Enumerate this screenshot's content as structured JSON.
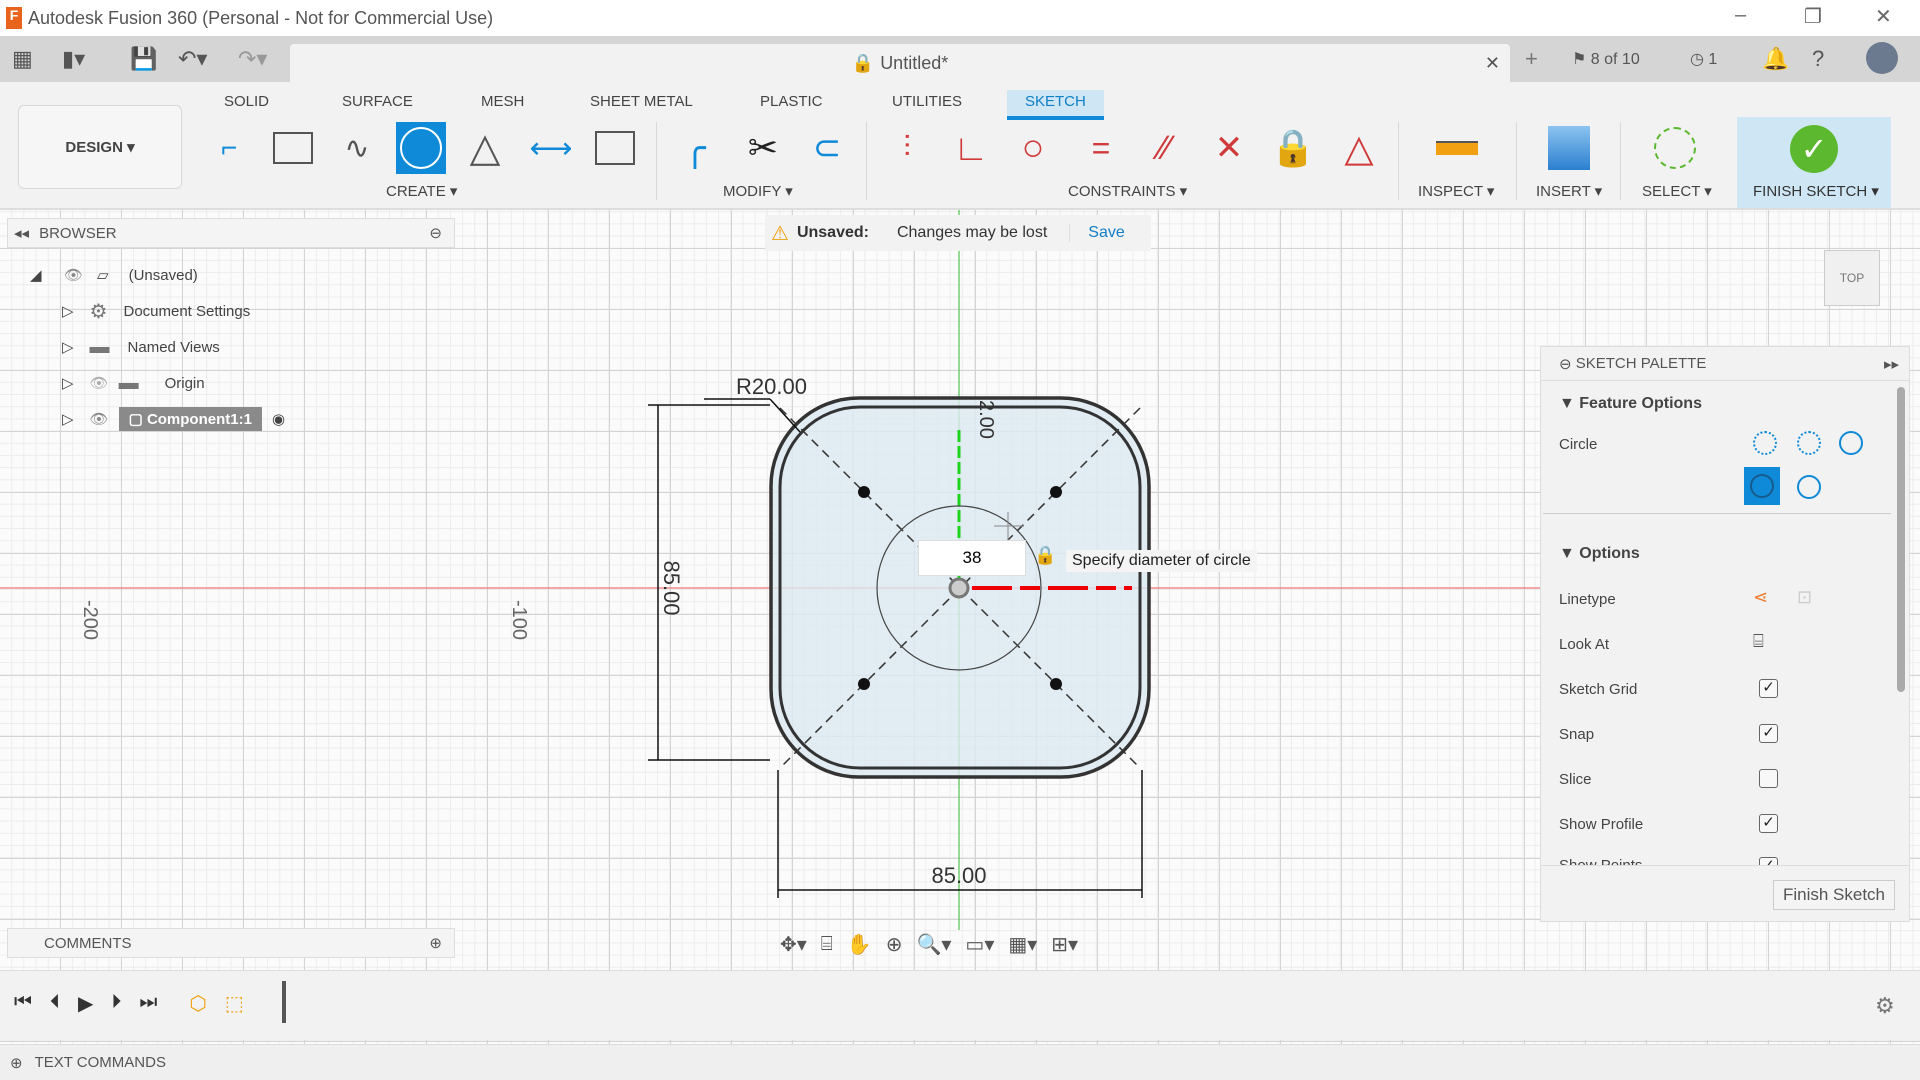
{
  "window": {
    "title": "Autodesk Fusion 360 (Personal - Not for Commercial Use)"
  },
  "tabbar": {
    "doc_title": "Untitled*",
    "jobs": "8 of 10",
    "clock_count": "1"
  },
  "ribbon": {
    "workspace": "DESIGN",
    "tabs": [
      "SOLID",
      "SURFACE",
      "MESH",
      "SHEET METAL",
      "PLASTIC",
      "UTILITIES",
      "SKETCH"
    ],
    "active_tab": "SKETCH",
    "groups": {
      "create": "CREATE",
      "modify": "MODIFY",
      "constraints": "CONSTRAINTS",
      "inspect": "INSPECT",
      "insert": "INSERT",
      "select": "SELECT",
      "finish": "FINISH SKETCH"
    }
  },
  "browser": {
    "title": "BROWSER",
    "items": [
      {
        "label": "(Unsaved)"
      },
      {
        "label": "Document Settings"
      },
      {
        "label": "Named Views"
      },
      {
        "label": "Origin"
      },
      {
        "label": "Component1:1"
      }
    ]
  },
  "unsaved": {
    "label": "Unsaved:",
    "message": "Changes may be lost",
    "save": "Save"
  },
  "sketch": {
    "radius_dim": "R20.00",
    "height_dim": "85.00",
    "width_dim": "85.00",
    "top_dim": "2.00",
    "diameter_input": "38",
    "tooltip": "Specify diameter of circle",
    "axis_labels": [
      "-200",
      "-100"
    ]
  },
  "viewcube": {
    "label": "TOP"
  },
  "palette": {
    "title": "SKETCH PALETTE",
    "feature_options": "Feature Options",
    "circle": "Circle",
    "options": "Options",
    "rows": [
      {
        "label": "Linetype"
      },
      {
        "label": "Look At"
      },
      {
        "label": "Sketch Grid",
        "checked": true
      },
      {
        "label": "Snap",
        "checked": true
      },
      {
        "label": "Slice",
        "checked": false
      },
      {
        "label": "Show Profile",
        "checked": true
      },
      {
        "label": "Show Points",
        "checked": true
      }
    ],
    "finish_button": "Finish Sketch"
  },
  "comments": {
    "title": "COMMENTS"
  },
  "textcommands": {
    "title": "TEXT COMMANDS"
  },
  "colors": {
    "accent": "#0f8ad8",
    "finish_green": "#5cb82e",
    "constraint_red": "#d03a3a"
  }
}
